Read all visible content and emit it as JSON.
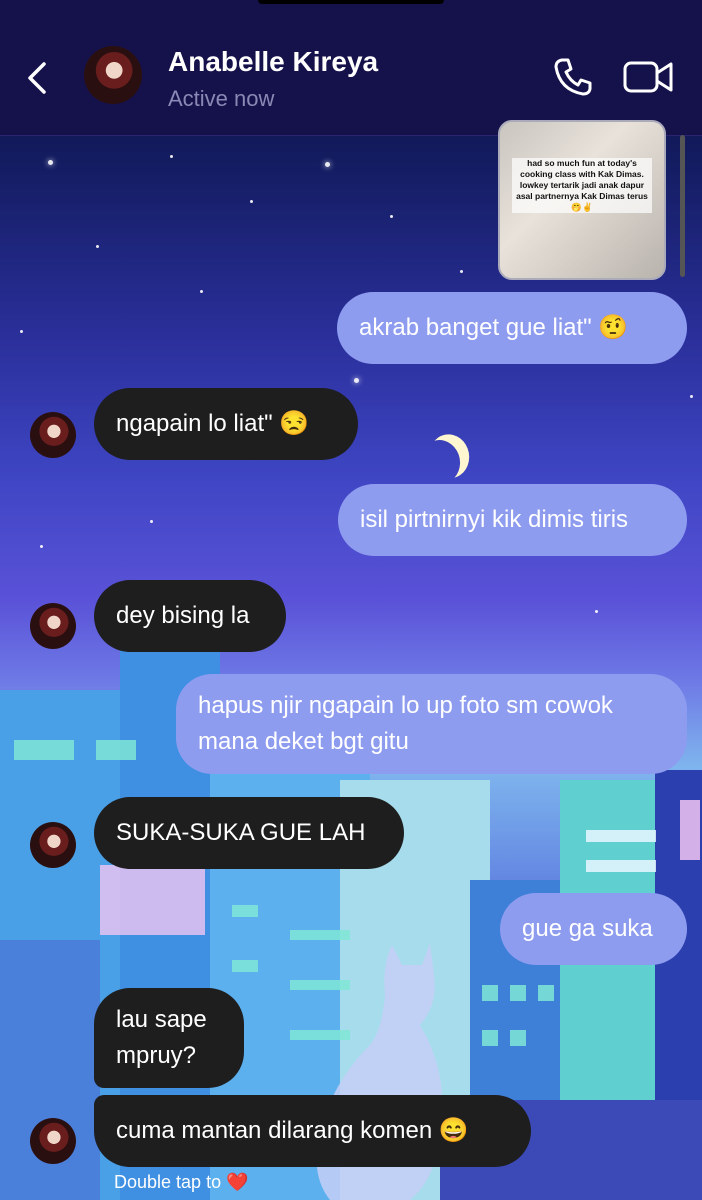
{
  "header": {
    "contact_name": "Anabelle Kireya",
    "status": "Active now",
    "back_icon": "chevron-left-icon",
    "call_icon": "phone-icon",
    "video_icon": "video-camera-icon"
  },
  "shared_post": {
    "caption": "had so much fun at today's cooking class with Kak Dimas. lowkey tertarik jadi anak dapur asal partnernya Kak Dimas terus🤭✌️"
  },
  "messages": [
    {
      "from": "me",
      "text": "akrab banget gue liat\" 🤨"
    },
    {
      "from": "them",
      "text": "ngapain lo liat\" 😒"
    },
    {
      "from": "me",
      "text": "isil pirtnirnyi kik dimis tiris"
    },
    {
      "from": "them",
      "text": "dey bising la"
    },
    {
      "from": "me",
      "text": "hapus njir ngapain lo up foto sm cowok mana deket bgt gitu"
    },
    {
      "from": "them",
      "text": "SUKA-SUKA GUE LAH"
    },
    {
      "from": "me",
      "text": "gue ga suka"
    },
    {
      "from": "them",
      "text": "lau sape mpruy?"
    },
    {
      "from": "them",
      "text": "cuma mantan dilarang komen 😄"
    }
  ],
  "footer": {
    "hint_text": "Double tap to",
    "heart": "❤️"
  },
  "colors": {
    "header_bg": "#15114a",
    "outgoing_bubble": "#8e9cf0",
    "incoming_bubble": "#1e1e1e"
  }
}
